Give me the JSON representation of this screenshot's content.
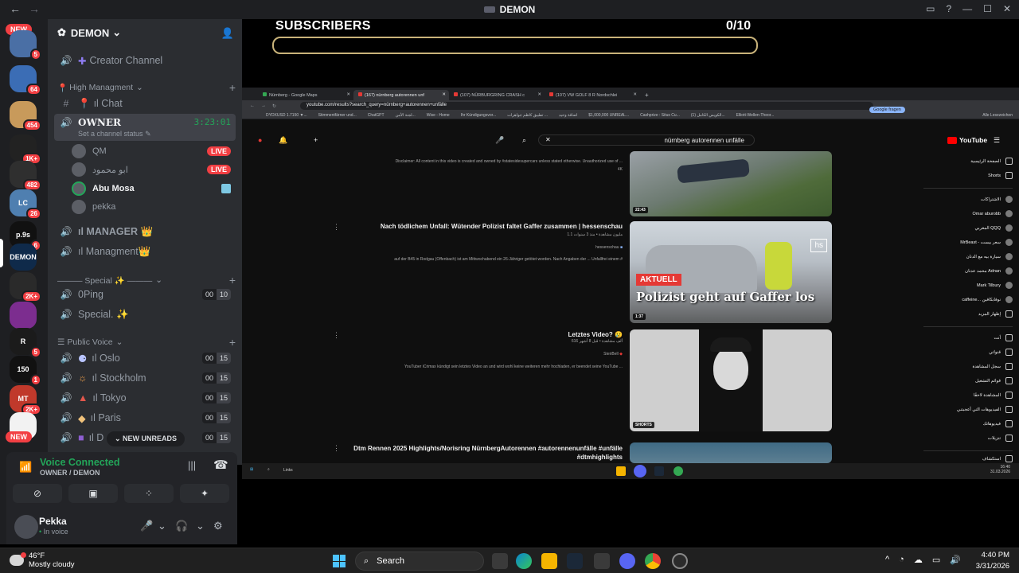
{
  "window": {
    "title": "DEMON"
  },
  "servers": [
    {
      "badge": "5",
      "color": "#4a6fa5",
      "label": ""
    },
    {
      "badge": "64",
      "color": "#3b6db5",
      "label": ""
    },
    {
      "badge": "454",
      "color": "#c89a5b",
      "label": ""
    },
    {
      "badge": "1K+",
      "color": "#222",
      "label": ""
    },
    {
      "badge": "482",
      "color": "#2f2f2f",
      "label": ""
    },
    {
      "badge": "26",
      "color": "#4f7fb0",
      "label": "LC"
    },
    {
      "badge": "6",
      "color": "#111",
      "label": "p.9s"
    },
    {
      "badge": "",
      "color": "#0f2a4a",
      "label": "DEMON"
    },
    {
      "badge": "2K+",
      "color": "#2a2a2a",
      "label": ""
    },
    {
      "badge": "",
      "color": "#7c2d8f",
      "label": ""
    },
    {
      "badge": "5",
      "color": "#1b1b1b",
      "label": "R"
    },
    {
      "badge": "1",
      "color": "#111",
      "label": "150"
    },
    {
      "badge": "2K+",
      "color": "#c0392b",
      "label": "MT"
    },
    {
      "badge": "",
      "color": "#f2f2f2",
      "label": ""
    }
  ],
  "rail_new_label": "NEW",
  "guild": {
    "name": "DEMON"
  },
  "channels": {
    "creator": "Creator Channel",
    "cat_high": "High Managment",
    "chat": "ıl Chat",
    "owner": "OWNER",
    "owner_timer": "3:23:01",
    "owner_status": "Set a channel status",
    "users": [
      {
        "name": "QM",
        "live": "LIVE"
      },
      {
        "name": "ابو محمود",
        "live": "LIVE"
      },
      {
        "name": "Abu Mosa",
        "live": ""
      },
      {
        "name": "pekka",
        "live": ""
      }
    ],
    "manager": "ıl MANAGER 👑",
    "managment": "ıl Managment👑",
    "cat_special": "——— Special ✨ ———",
    "oping": "0Ping",
    "oping_a": "00",
    "oping_b": "10",
    "special": "Special. ✨",
    "cat_public": "Public Voice",
    "public": [
      {
        "name": "ıl Oslo",
        "a": "00",
        "b": "15",
        "icon": "⚈"
      },
      {
        "name": "ıl Stockholm",
        "a": "00",
        "b": "15",
        "icon": "☼"
      },
      {
        "name": "ıl Tokyo",
        "a": "00",
        "b": "15",
        "icon": "▲"
      },
      {
        "name": "ıl Paris",
        "a": "00",
        "b": "15",
        "icon": "◆"
      },
      {
        "name": "ıl D",
        "a": "00",
        "b": "15",
        "icon": "■"
      }
    ],
    "new_unreads": "NEW UNREADS"
  },
  "voice": {
    "status": "Voice Connected",
    "location": "OWNER / DEMON"
  },
  "me": {
    "name": "Pekka",
    "status": "In voice"
  },
  "stream": {
    "subs_label": "SUBSCRIBERS",
    "subs_count": "0/10",
    "progress": 0
  },
  "browser": {
    "tabs": [
      "Nürnberg - Google Maps",
      "(167) nürnberg autorennen unf",
      "(107) NÜRBURGRING CRASH c",
      "(107) VW GOLF 8 R Nordschlei"
    ],
    "url": "youtube.com/results?search_query=nürnberg+autorennen+unfälle",
    "google_btn": "Google fragen",
    "bookmarks": [
      "DYDXUSD 1.7150 ▼...",
      "Stimmentfärner und...",
      "ChatGPT",
      "لجنة الأمن...",
      "Wise - Home",
      "Ihr Kündigungsvor...",
      "تطبيق كاظم جواهرات ...",
      "اضافة وحيد",
      "$1,000,000 UNREAL...",
      "Cashprize : Situs Cu...",
      "(1) الكويس الكامل...",
      "Elliott-Wellen-Theor..."
    ],
    "all_bookmarks": "Alle Lesezeichen"
  },
  "youtube": {
    "search": "nürnberg autorennen unfälle",
    "logo": "YouTube",
    "results": [
      {
        "title": "",
        "meta": "",
        "channel": "",
        "desc": "Disclaimer: All content in this video is created and owned by #statesidesupercars unless stated otherwise. Unauthorized use of ...",
        "duration": "22:43",
        "tag": "4K"
      },
      {
        "title": "Nach tödlichem Unfall: Wütender Polizist faltet Gaffer zusammen | hessenschau",
        "meta": "1.1 مليون مشاهدة • منذ 3 سنوات",
        "channel": "hessenschau",
        "desc": "auf der B45 in Rodgau (Offenbach) ist am Mittwochabend ein 26-Jähriger getötet worden. Nach Angaben der ... Unfallfrei einem #",
        "duration": "1:37",
        "badge": "AKTUELL",
        "overlay": "Polizist geht auf Gaffer los",
        "logo": "hs"
      },
      {
        "title": "Letztes Video? 😢",
        "meta": "616 ألف مشاهدة • قبل 8 أشهر",
        "channel": "SteirBell",
        "desc": "YouTuber iCrimax kündigt sein letztes Video an und wird wohl keine weiteren mehr hochladen, er beendet seine YouTube ...",
        "duration": "SHORTS"
      },
      {
        "title": "Dtm Rennen 2025 Highlights/Norisring NürnbergAutorennen #autorennenunfälle #unfälle #dtmhighlights",
        "meta": "",
        "channel": "",
        "desc": "",
        "duration": ""
      }
    ],
    "sidebar": {
      "home": "الصفحة الرئيسية",
      "shorts": "Shorts",
      "subs_header": "الاشتراكات",
      "subs": [
        "Omar aburobb",
        "المغربي QQQ",
        "MrBeast - سعر بيست",
        "سيارة بيه مع الدنان",
        "محمد عدنان Adnan",
        "Mark Tilbury",
        "caffeine... نوفابكافين"
      ],
      "show_more": "إظهار المزيد",
      "you_header": "أنت",
      "you": [
        "قنواتي",
        "سجل المشاهدة",
        "قوائم التشغيل",
        "المشاهدة لاحقًا",
        "الفيديوهات التي أعجبتني",
        "فيديوهاتك",
        "تنزيلات"
      ],
      "explore": "استكشاف"
    },
    "inner_taskbar": {
      "search": "Links",
      "time": "16:40",
      "date": "31.03.2026"
    }
  },
  "taskbar": {
    "weather_temp": "46°F",
    "weather_desc": "Mostly cloudy",
    "search": "Search",
    "time": "4:40 PM",
    "date": "3/31/2026"
  }
}
